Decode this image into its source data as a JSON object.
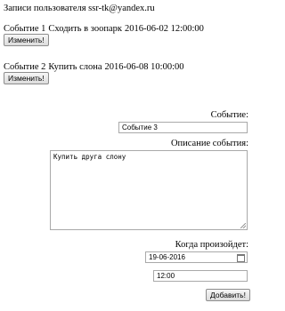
{
  "page": {
    "title": "Записи пользователя ssr-tk@yandex.ru"
  },
  "events": [
    {
      "label": "Событие 1",
      "name": "Сходить в зоопарк",
      "datetime": "2016-06-02 12:00:00",
      "edit_label": "Изменить!"
    },
    {
      "label": "Событие 2",
      "name": "Купить слона",
      "datetime": "2016-06-08 10:00:00",
      "edit_label": "Изменить!"
    }
  ],
  "form": {
    "event_label": "Событие:",
    "event_value": "Событие 3",
    "description_label": "Описание события:",
    "description_value": "Купить друга слону",
    "when_label": "Когда произойдет:",
    "date_value": "19-06-2016",
    "time_value": "12:00",
    "submit_label": "Добавить!"
  },
  "icons": {
    "calendar": "calendar-icon",
    "resize": "resize-grip-icon"
  }
}
